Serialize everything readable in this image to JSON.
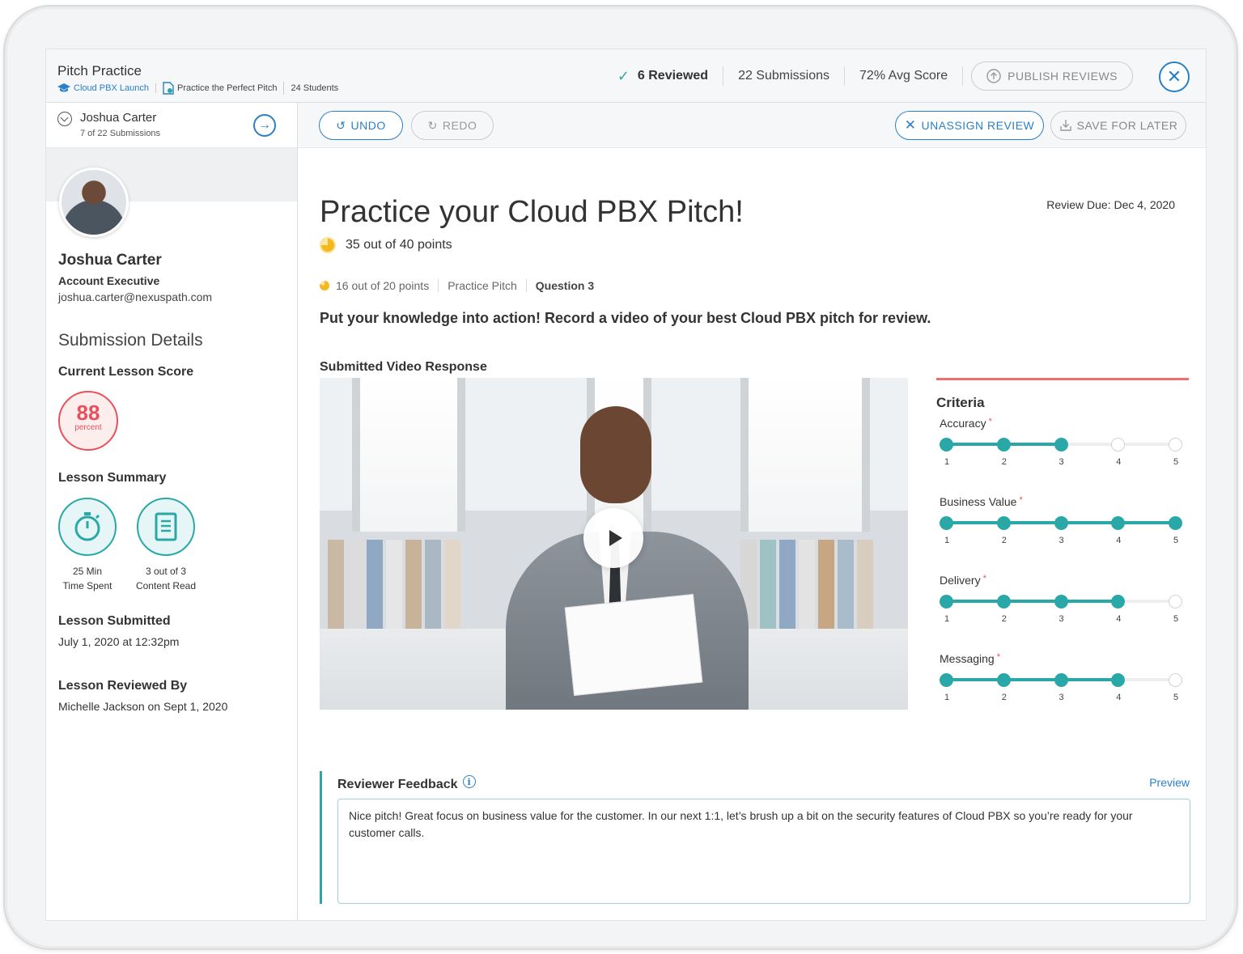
{
  "header": {
    "title": "Pitch Practice",
    "breadcrumbs": [
      {
        "label": "Cloud PBX Launch",
        "icon": "graduation-cap-icon"
      },
      {
        "label": "Practice the Perfect Pitch",
        "icon": "document-check-icon"
      },
      {
        "label": "24 Students"
      }
    ],
    "stats": {
      "reviewed": "6 Reviewed",
      "submissions": "22 Submissions",
      "avg_score": "72% Avg Score"
    },
    "publish_label": "PUBLISH REVIEWS"
  },
  "sidebar": {
    "student_name": "Joshua Carter",
    "student_position": "7 of 22 Submissions",
    "profile": {
      "name": "Joshua Carter",
      "role": "Account Executive",
      "email": "joshua.carter@nexuspath.com"
    },
    "section_title": "Submission Details",
    "current_score_label": "Current Lesson Score",
    "current_score_value": "88",
    "current_score_unit": "percent",
    "lesson_summary_label": "Lesson Summary",
    "summary": [
      {
        "line1": "25 Min",
        "line2": "Time Spent",
        "icon": "stopwatch-icon"
      },
      {
        "line1": "3 out of 3",
        "line2": "Content Read",
        "icon": "document-icon"
      }
    ],
    "submitted_label": "Lesson Submitted",
    "submitted_value": "July 1, 2020 at 12:32pm",
    "reviewed_label": "Lesson Reviewed By",
    "reviewed_value": "Michelle Jackson on Sept 1, 2020"
  },
  "toolbar": {
    "undo": "UNDO",
    "redo": "REDO",
    "unassign": "UNASSIGN REVIEW",
    "save": "SAVE FOR LATER"
  },
  "main": {
    "title": "Practice your Cloud PBX Pitch!",
    "points": "35 out of 40 points",
    "review_due": "Review Due: Dec 4, 2020",
    "question_points": "16 out of 20 points",
    "question_type": "Practice Pitch",
    "question_number": "Question 3",
    "prompt": "Put your knowledge into action! Record a video of your best Cloud PBX pitch for review.",
    "video_label": "Submitted Video Response"
  },
  "criteria": {
    "title": "Criteria",
    "scale": [
      "1",
      "2",
      "3",
      "4",
      "5"
    ],
    "items": [
      {
        "name": "Accuracy",
        "required": "*",
        "value": 3
      },
      {
        "name": "Business Value",
        "required": "*",
        "value": 5
      },
      {
        "name": "Delivery",
        "required": "*",
        "value": 4
      },
      {
        "name": "Messaging",
        "required": "*",
        "value": 4
      }
    ]
  },
  "feedback": {
    "label": "Reviewer Feedback",
    "preview": "Preview",
    "text": "Nice pitch! Great focus on business value for the customer. In our next 1:1, let’s brush up a bit on the security features of Cloud PBX so you’re ready for your customer calls."
  },
  "colors": {
    "accent_blue": "#2a7fc9",
    "teal": "#2aa8a8",
    "score_red": "#e8505b"
  }
}
